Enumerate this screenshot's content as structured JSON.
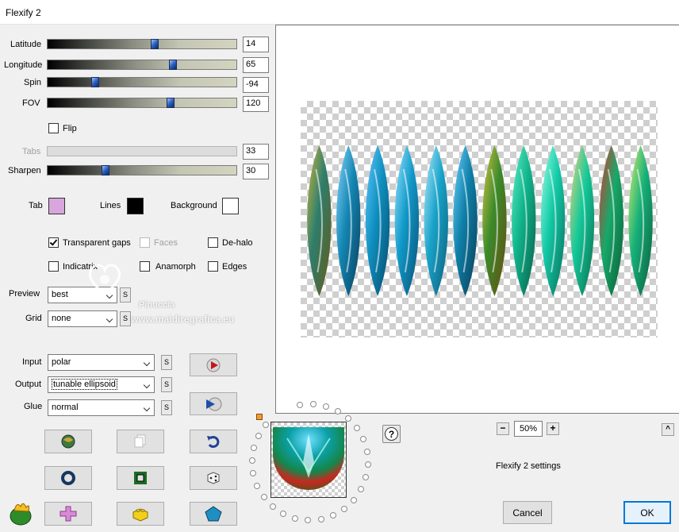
{
  "window": {
    "title": "Flexify 2"
  },
  "sliders": [
    {
      "label": "Latitude",
      "value": "14",
      "fraction": 0.57,
      "enabled": true
    },
    {
      "label": "Longitude",
      "value": "65",
      "fraction": 0.67,
      "enabled": true
    },
    {
      "label": "Spin",
      "value": "-94",
      "fraction": 0.24,
      "enabled": true
    },
    {
      "label": "FOV",
      "value": "120",
      "fraction": 0.66,
      "enabled": true
    },
    {
      "label": "Tabs",
      "value": "33",
      "fraction": 0.0,
      "enabled": false
    },
    {
      "label": "Sharpen",
      "value": "30",
      "fraction": 0.3,
      "enabled": true
    }
  ],
  "flip": {
    "label": "Flip",
    "checked": false
  },
  "colors": {
    "tab": {
      "label": "Tab",
      "value": "#d8a6dc"
    },
    "lines": {
      "label": "Lines",
      "value": "#000000"
    },
    "background": {
      "label": "Background",
      "value": "#ffffff"
    }
  },
  "options": {
    "transparent_gaps": {
      "label": "Transparent gaps",
      "checked": true
    },
    "faces": {
      "label": "Faces",
      "checked": false
    },
    "de_halo": {
      "label": "De-halo",
      "checked": false
    },
    "indicatrix": {
      "label": "Indicatrix",
      "checked": false
    },
    "anamorph": {
      "label": "Anamorph",
      "checked": false
    },
    "edges": {
      "label": "Edges",
      "checked": false
    }
  },
  "preview": {
    "label": "Preview",
    "value": "best"
  },
  "grid": {
    "label": "Grid",
    "value": "none"
  },
  "input": {
    "label": "Input",
    "value": "polar"
  },
  "output": {
    "label": "Output",
    "value": "tunable ellipsoid"
  },
  "glue": {
    "label": "Glue",
    "value": "normal"
  },
  "s_button": "S",
  "watermark": {
    "name": "Pinuccia",
    "site": "www.maidiregrafica.eu"
  },
  "zoom": {
    "value": "50%",
    "minus": "−",
    "plus": "+"
  },
  "help_label": "?",
  "collapse_label": "^",
  "status_text": "Flexify 2 settings",
  "buttons": {
    "cancel": "Cancel",
    "ok": "OK"
  }
}
